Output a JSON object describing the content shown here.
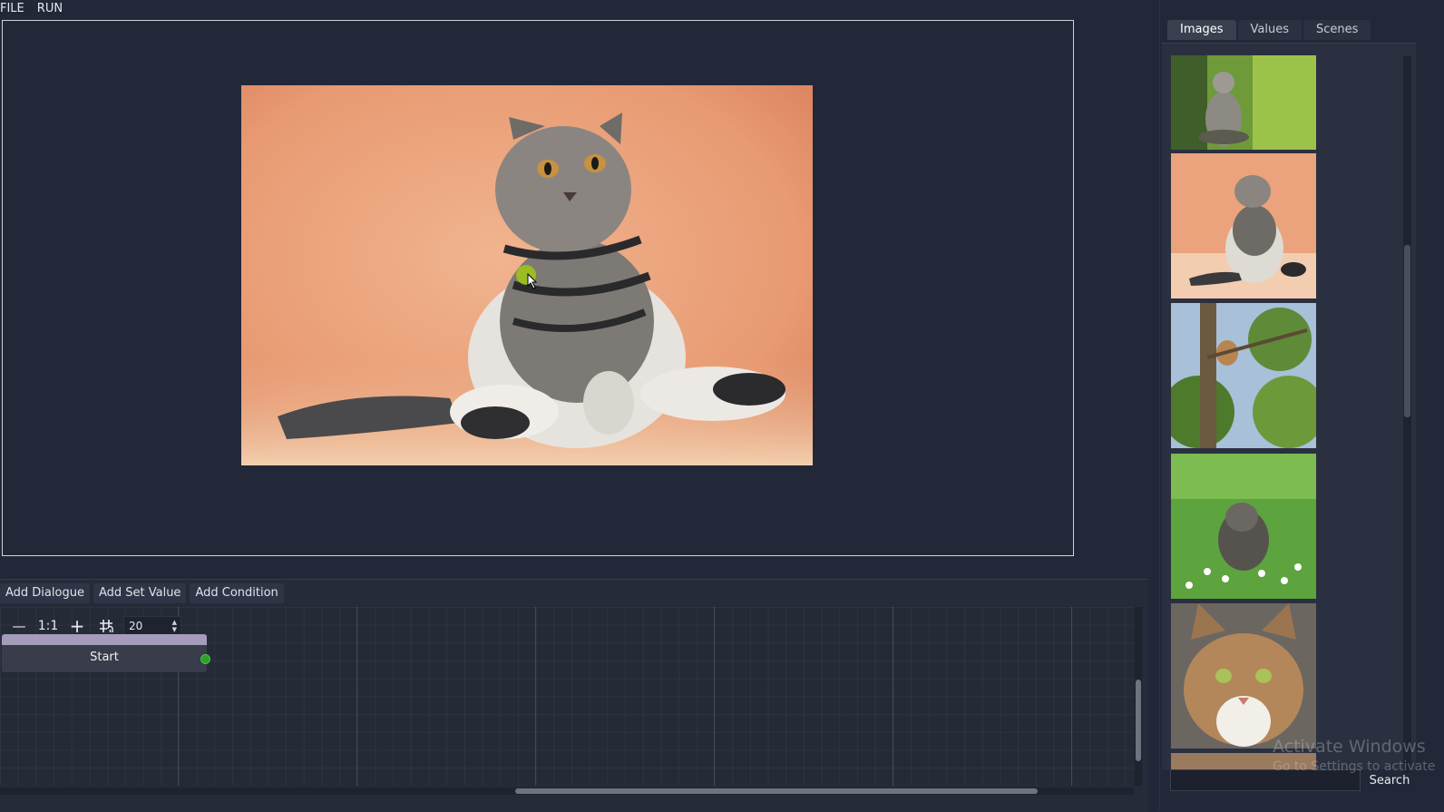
{
  "menu": {
    "file": "FILE",
    "run": "RUN"
  },
  "toolbar": {
    "add_dialogue": "Add Dialogue",
    "add_set_value": "Add Set Value",
    "add_condition": "Add Condition"
  },
  "graph": {
    "zoom_out": "—",
    "zoom_reset": "1:1",
    "zoom_in": "+",
    "snap_icon": "snap-grid-icon",
    "snap_value": "20",
    "start_node_label": "Start"
  },
  "tabs": [
    "Images",
    "Values",
    "Scenes"
  ],
  "images": [
    {
      "name": "cat-sitting-grass-thumbnail"
    },
    {
      "name": "scottish-fold-cat-thumbnail"
    },
    {
      "name": "kitten-in-tree-thumbnail"
    },
    {
      "name": "kitten-in-flowers-thumbnail"
    },
    {
      "name": "tabby-cat-portrait-thumbnail"
    }
  ],
  "search": {
    "value": "",
    "button": "Search"
  },
  "watermark": {
    "line1": "Activate Windows",
    "line2": "Go to Settings to activate"
  },
  "colors": {
    "background": "#232838",
    "node_header": "#a59cbb",
    "port": "#2fa02b",
    "cursor_highlight": "#a0c814"
  }
}
